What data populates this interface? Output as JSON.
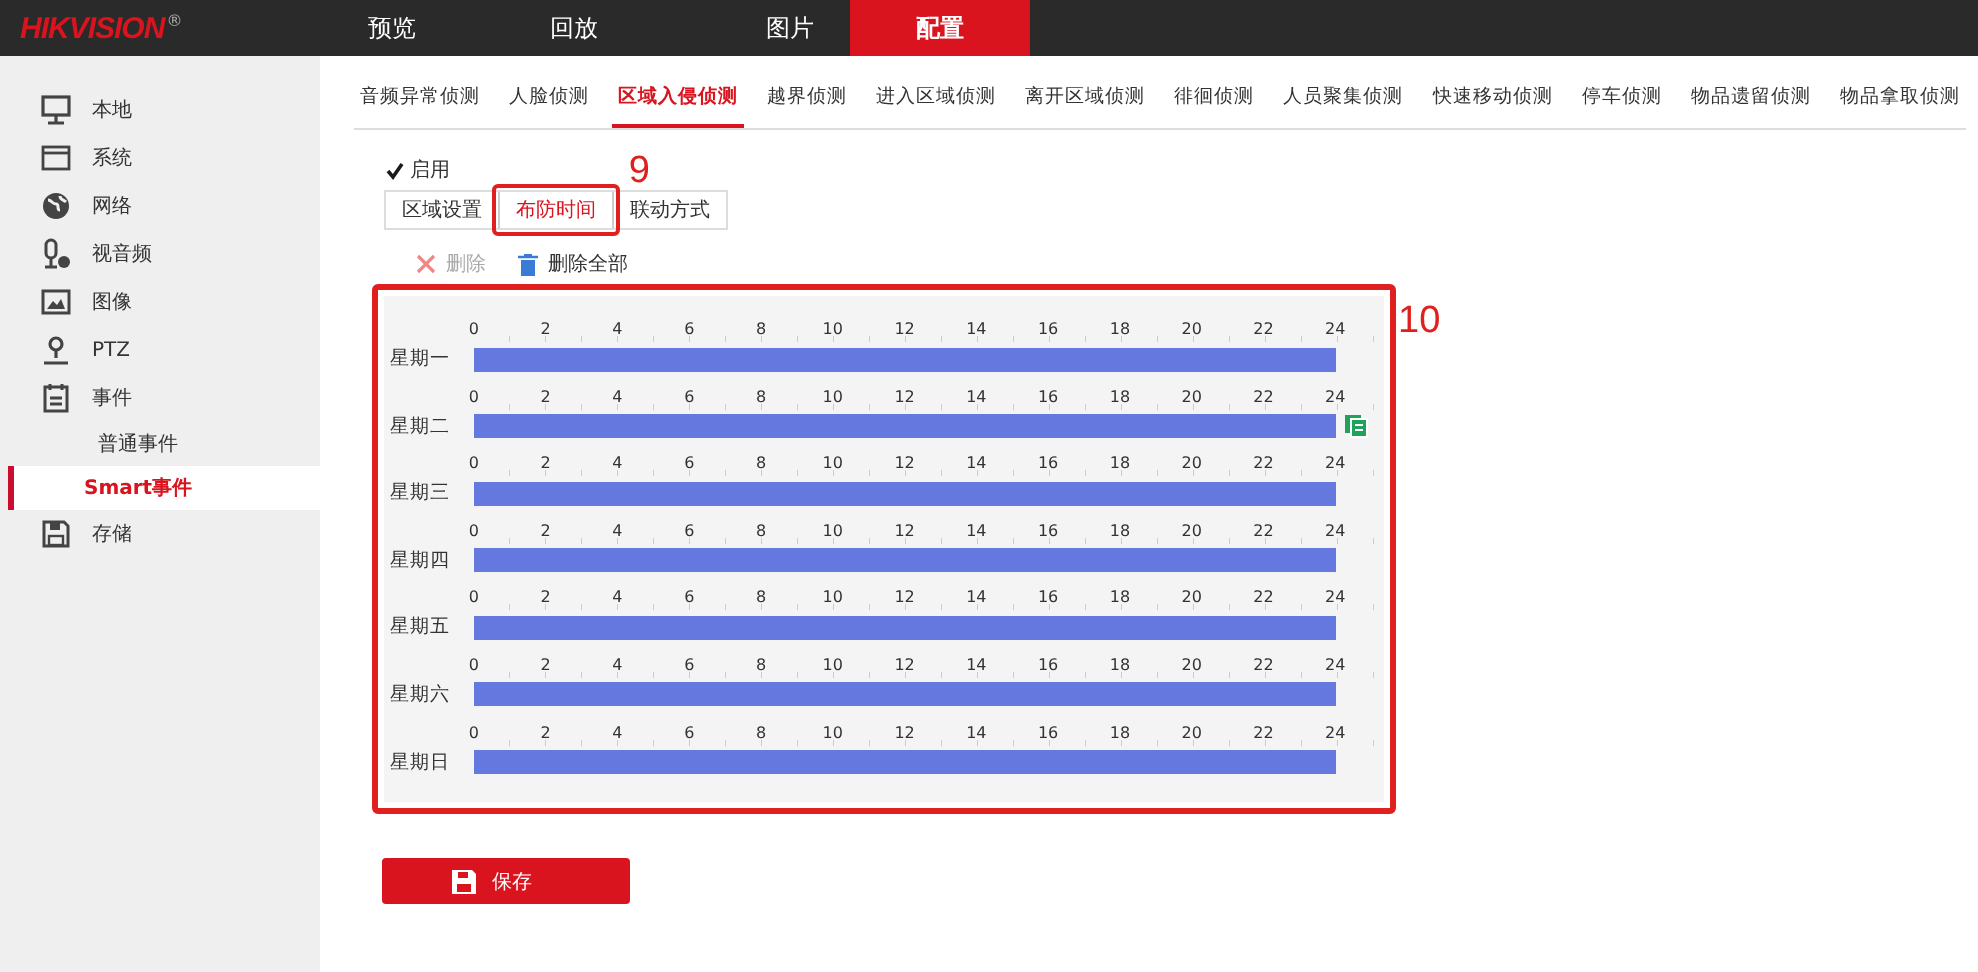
{
  "header": {
    "logo": "HIKVISION",
    "logo_mark": "®",
    "nav": [
      {
        "label": "预览",
        "selected": false
      },
      {
        "label": "回放",
        "selected": false
      },
      {
        "label": "图片",
        "selected": false
      },
      {
        "label": "配置",
        "selected": true
      }
    ]
  },
  "sidebar": {
    "items": [
      {
        "label": "本地",
        "selected": false
      },
      {
        "label": "系统",
        "selected": false
      },
      {
        "label": "网络",
        "selected": false
      },
      {
        "label": "视音频",
        "selected": false
      },
      {
        "label": "图像",
        "selected": false
      },
      {
        "label": "PTZ",
        "selected": false
      },
      {
        "label": "事件",
        "selected": false,
        "children": [
          {
            "label": "普通事件",
            "selected": false
          },
          {
            "label": "Smart事件",
            "selected": true
          }
        ]
      },
      {
        "label": "存储",
        "selected": false
      }
    ]
  },
  "tabs": [
    {
      "label": "音频异常侦测",
      "selected": false
    },
    {
      "label": "人脸侦测",
      "selected": false
    },
    {
      "label": "区域入侵侦测",
      "selected": true
    },
    {
      "label": "越界侦测",
      "selected": false
    },
    {
      "label": "进入区域侦测",
      "selected": false
    },
    {
      "label": "离开区域侦测",
      "selected": false
    },
    {
      "label": "徘徊侦测",
      "selected": false
    },
    {
      "label": "人员聚集侦测",
      "selected": false
    },
    {
      "label": "快速移动侦测",
      "selected": false
    },
    {
      "label": "停车侦测",
      "selected": false
    },
    {
      "label": "物品遗留侦测",
      "selected": false
    },
    {
      "label": "物品拿取侦测",
      "selected": false
    }
  ],
  "enable": {
    "label": "启用",
    "checked": true
  },
  "subtabs": [
    {
      "label": "区域设置",
      "selected": false
    },
    {
      "label": "布防时间",
      "selected": true,
      "annotation": "9"
    },
    {
      "label": "联动方式",
      "selected": false
    }
  ],
  "toolbar": [
    {
      "label": "删除",
      "kind": "delete",
      "disabled": true
    },
    {
      "label": "删除全部",
      "kind": "delete_all",
      "disabled": false
    }
  ],
  "schedule": {
    "annotation": "10",
    "days": [
      {
        "label": "星期一",
        "scale": [
          "0",
          "2",
          "4",
          "6",
          "8",
          "10",
          "12",
          "14",
          "16",
          "18",
          "20",
          "22",
          "24"
        ],
        "level": 1,
        "copy": false
      },
      {
        "label": "星期二",
        "scale": [
          "0",
          "2",
          "4",
          "6",
          "8",
          "10",
          "12",
          "14",
          "16",
          "18",
          "20",
          "22",
          "24"
        ],
        "level": 1,
        "copy": true
      },
      {
        "label": "星期三",
        "scale": [
          "0",
          "2",
          "4",
          "6",
          "8",
          "10",
          "12",
          "14",
          "16",
          "18",
          "20",
          "22",
          "24"
        ],
        "level": 1,
        "copy": false
      },
      {
        "label": "星期四",
        "scale": [
          "0",
          "2",
          "4",
          "6",
          "8",
          "10",
          "12",
          "14",
          "16",
          "18",
          "20",
          "22",
          "24"
        ],
        "level": 1,
        "copy": false
      },
      {
        "label": "星期五",
        "scale": [
          "0",
          "2",
          "4",
          "6",
          "8",
          "10",
          "12",
          "14",
          "16",
          "18",
          "20",
          "22",
          "24"
        ],
        "level": 1,
        "copy": false
      },
      {
        "label": "星期六",
        "scale": [
          "0",
          "2",
          "4",
          "6",
          "8",
          "10",
          "12",
          "14",
          "16",
          "18",
          "20",
          "22",
          "24"
        ],
        "level": 1,
        "copy": false
      },
      {
        "label": "星期日",
        "scale": [
          "0",
          "2",
          "4",
          "6",
          "8",
          "10",
          "12",
          "14",
          "16",
          "18",
          "20",
          "22",
          "24"
        ],
        "level": 1,
        "copy": false
      }
    ]
  },
  "save_button": {
    "label": "保存"
  }
}
